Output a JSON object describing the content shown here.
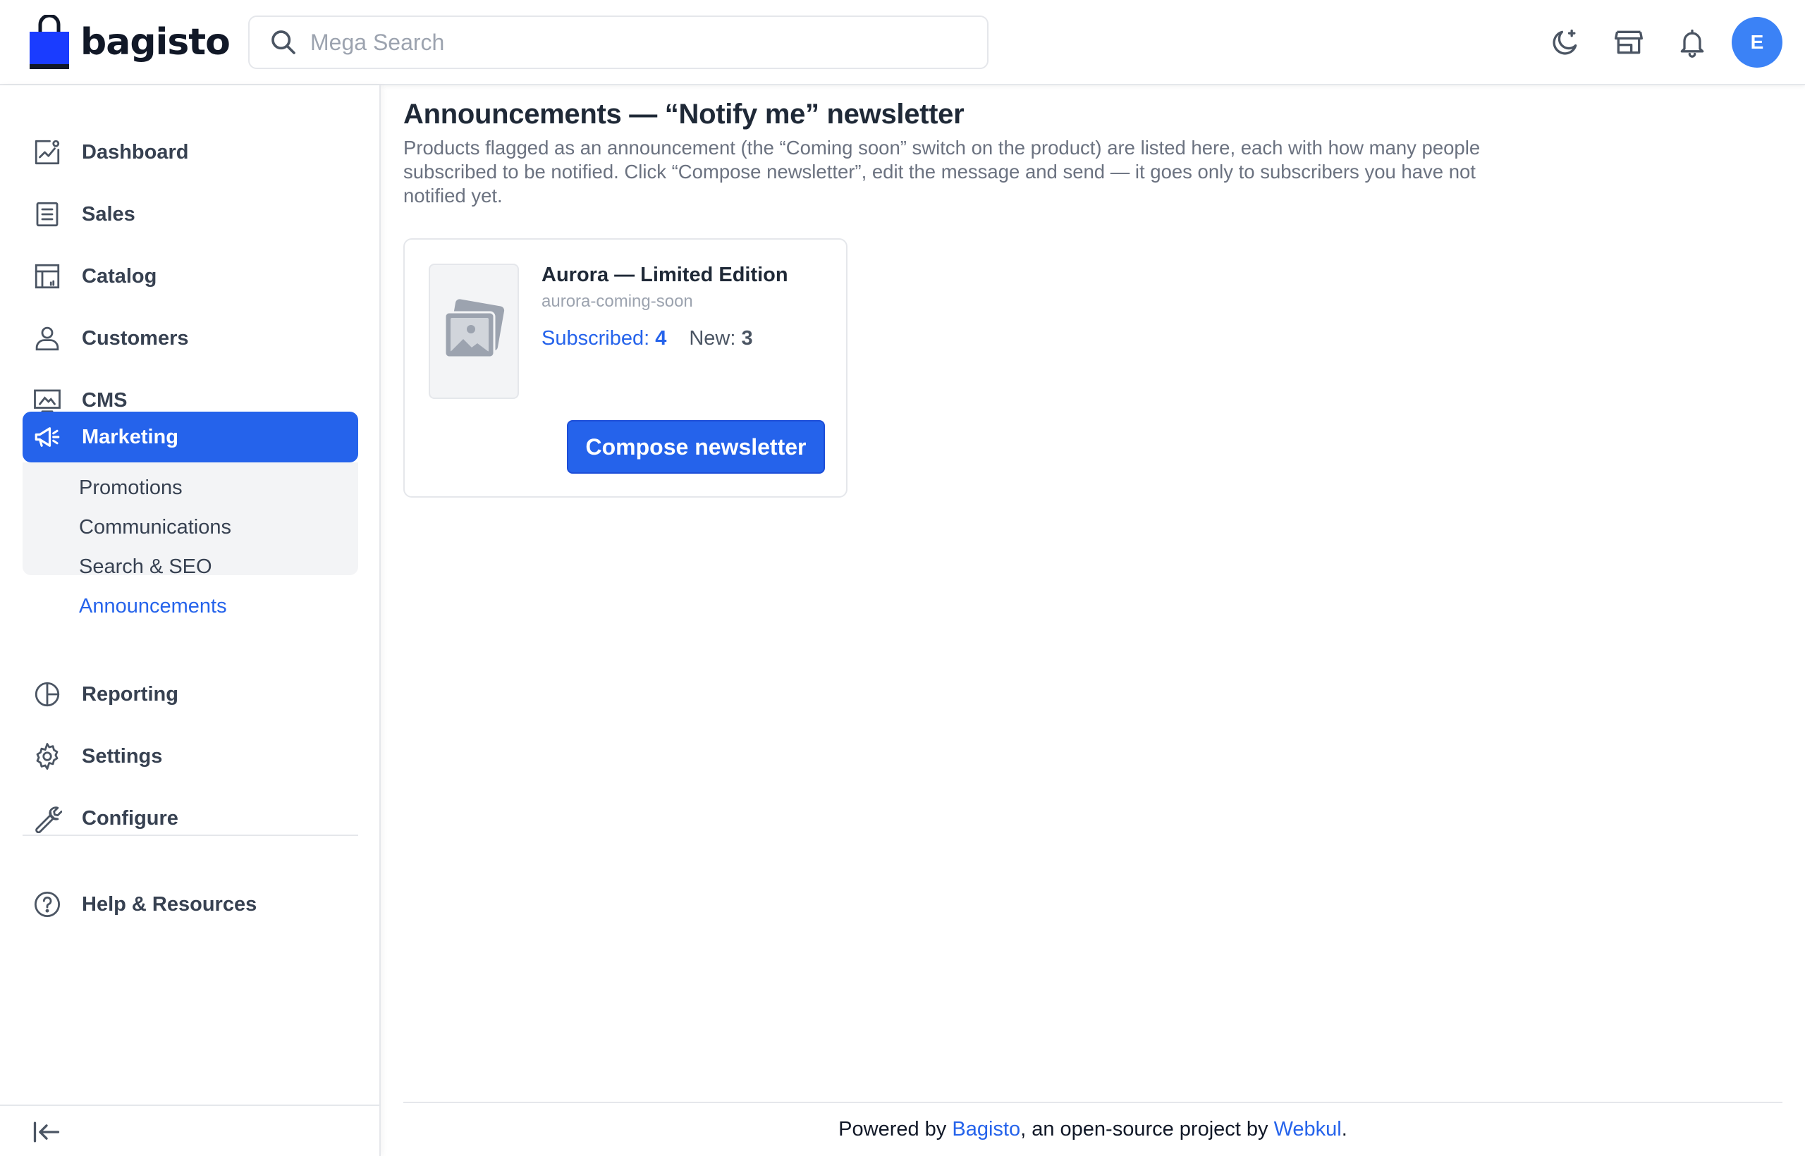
{
  "brand": {
    "name": "bagisto"
  },
  "search": {
    "placeholder": "Mega Search"
  },
  "header": {
    "icons": [
      "theme-toggle-icon",
      "storefront-icon",
      "notifications-icon"
    ],
    "avatar_initial": "E"
  },
  "sidebar": {
    "items": [
      {
        "label": "Dashboard",
        "icon": "dashboard-icon"
      },
      {
        "label": "Sales",
        "icon": "sales-icon"
      },
      {
        "label": "Catalog",
        "icon": "catalog-icon"
      },
      {
        "label": "Customers",
        "icon": "customers-icon"
      },
      {
        "label": "CMS",
        "icon": "cms-icon"
      },
      {
        "label": "Marketing",
        "icon": "megaphone-icon",
        "active": true
      },
      {
        "label": "Reporting",
        "icon": "reporting-icon"
      },
      {
        "label": "Settings",
        "icon": "gear-icon"
      },
      {
        "label": "Configure",
        "icon": "wrench-icon"
      },
      {
        "label": "Help & Resources",
        "icon": "help-icon"
      }
    ],
    "marketing_submenu": [
      {
        "label": "Promotions"
      },
      {
        "label": "Communications"
      },
      {
        "label": "Search & SEO"
      },
      {
        "label": "Announcements",
        "active": true
      }
    ]
  },
  "main": {
    "title": "Announcements — “Notify me” newsletter",
    "description": "Products flagged as an announcement (the “Coming soon” switch on the product) are listed here, each with how many people subscribed to be notified. Click “Compose newsletter”, edit the message and send — it goes only to subscribers you have not notified yet.",
    "products": [
      {
        "name": "Aurora — Limited Edition",
        "sku": "aurora-coming-soon",
        "subscribed_label": "Subscribed:",
        "subscribed_count": "4",
        "new_label": "New:",
        "new_count": "3",
        "action_label": "Compose newsletter"
      }
    ]
  },
  "footer": {
    "prefix": "Powered by ",
    "link1": "Bagisto",
    "middle": ", an open-source project by ",
    "link2": "Webkul",
    "suffix": "."
  },
  "colors": {
    "accent": "#2563eb",
    "avatar": "#3b82f6"
  }
}
